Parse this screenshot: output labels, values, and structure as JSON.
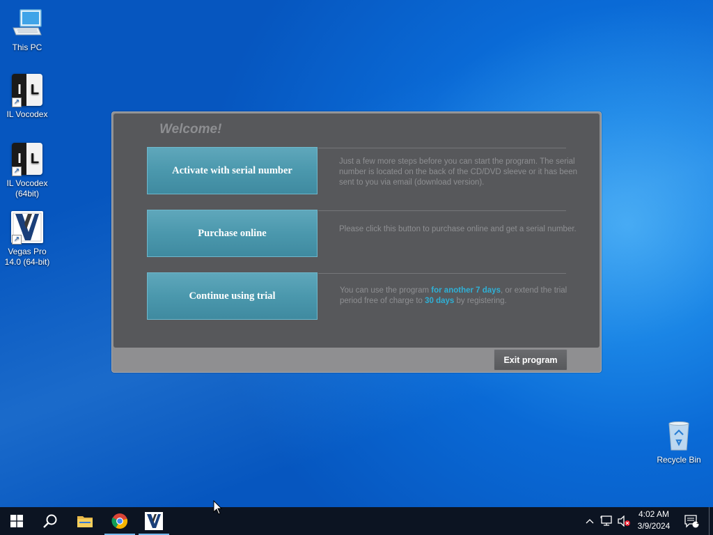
{
  "desktop": {
    "icons": [
      {
        "label": "This PC"
      },
      {
        "label": "IL Vocodex"
      },
      {
        "label": "IL Vocodex (64bit)"
      },
      {
        "label": "Vegas Pro 14.0 (64-bit)"
      },
      {
        "label": "Recycle Bin"
      }
    ]
  },
  "dialog": {
    "welcome": "Welcome!",
    "options": [
      {
        "button": "Activate with serial number",
        "description": "Just a few more steps before you can start the program. The serial number is located on the back of the CD/DVD sleeve or it has been sent to you via email (download version)."
      },
      {
        "button": "Purchase online",
        "description": "Please click this button to purchase online and get a serial number."
      },
      {
        "button": "Continue using trial",
        "desc_part1": "You can use the program ",
        "desc_hl1": "for another 7 days",
        "desc_part2": ", or extend the trial period free of charge to ",
        "desc_hl2": "30 days",
        "desc_part3": " by registering."
      }
    ],
    "exit_button": "Exit program"
  },
  "taskbar": {
    "time": "4:02 AM",
    "date": "3/9/2024",
    "notification_count": "1",
    "icons": [
      "windows-start-icon",
      "search-icon",
      "file-explorer-icon",
      "chrome-icon",
      "vegas-pro-icon"
    ]
  },
  "colors": {
    "dialog_bg": "#57585b",
    "button_teal": "#4b98ad",
    "highlight": "#2fb0d6"
  }
}
